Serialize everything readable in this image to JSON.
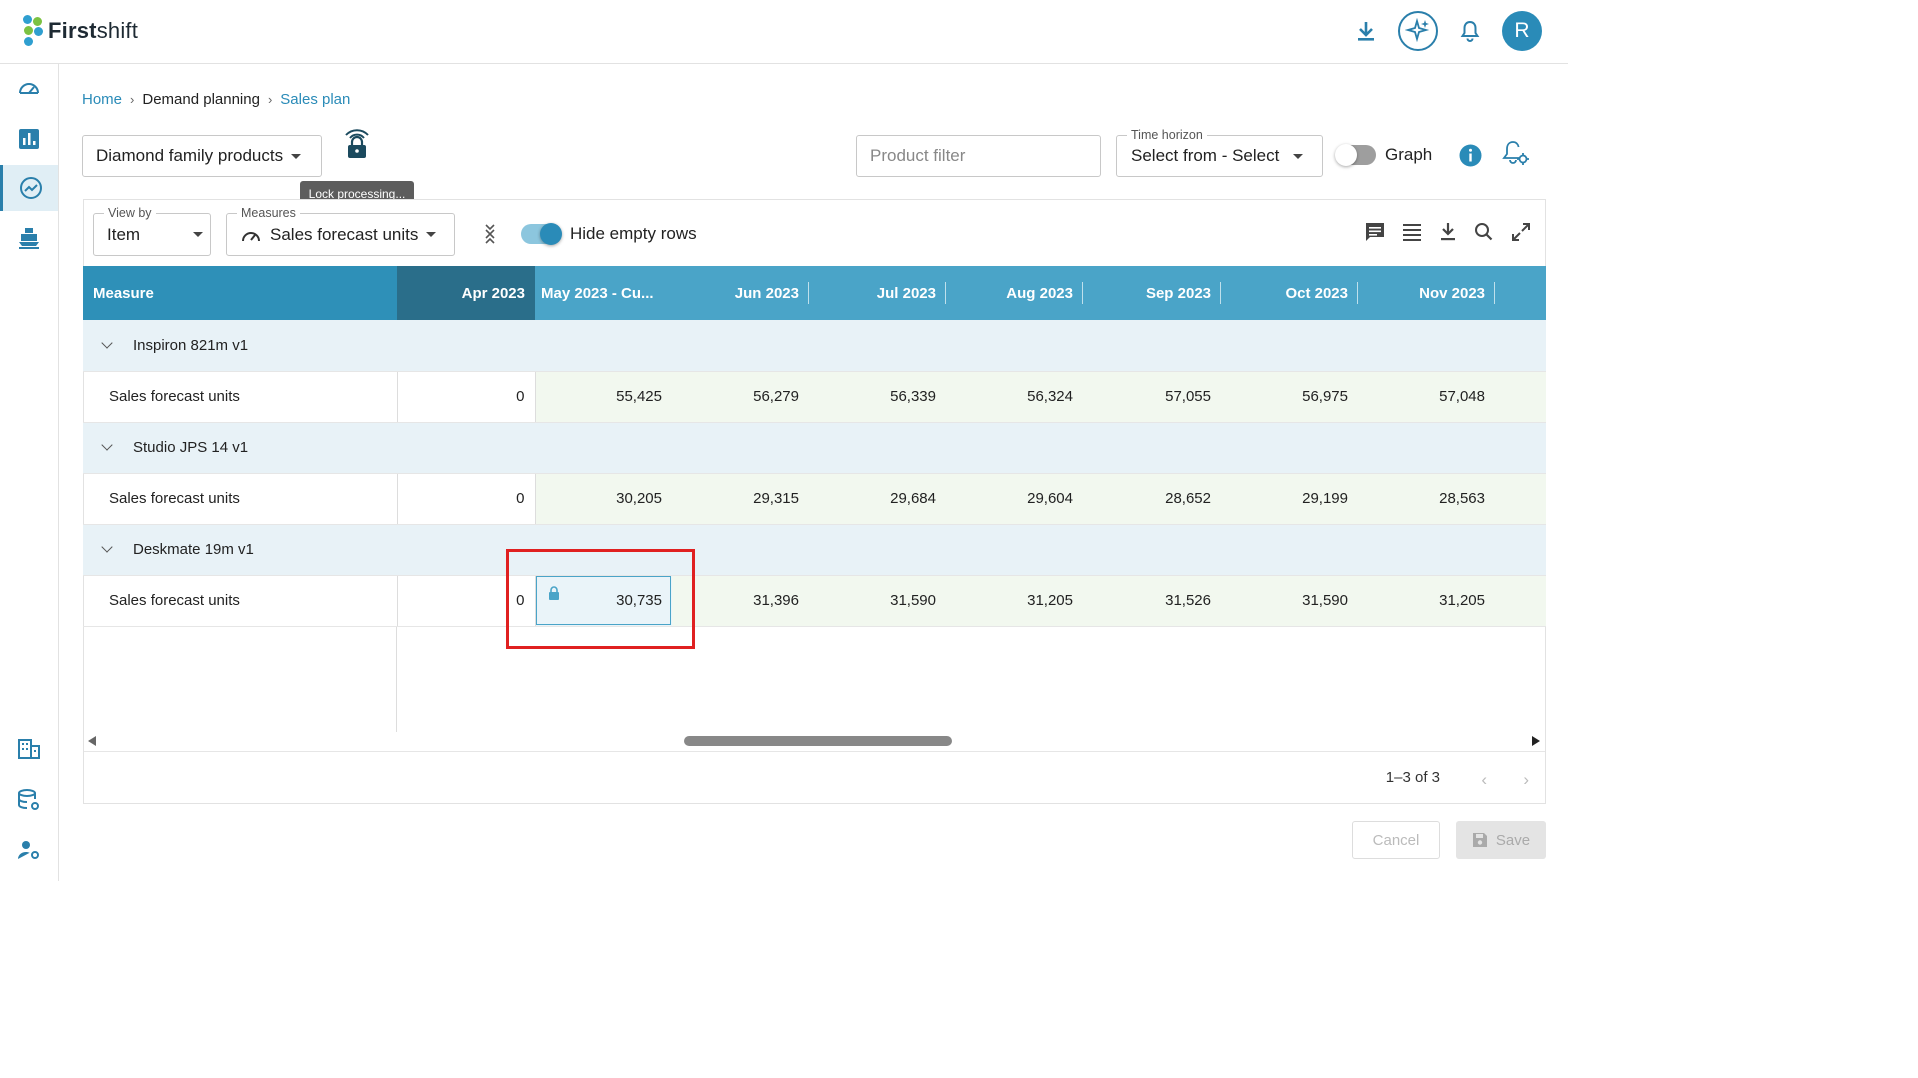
{
  "app": {
    "logo_bold": "First",
    "logo_rest": "shift"
  },
  "header": {
    "avatar_initial": "R",
    "icons": [
      "download-icon",
      "ai-sparkle-icon",
      "bell-icon"
    ]
  },
  "sidebar": {
    "items": [
      "dashboard-icon",
      "bar-chart-icon",
      "trend-icon",
      "ship-icon",
      "building-icon",
      "database-settings-icon",
      "user-settings-icon"
    ],
    "active": "trend-icon"
  },
  "breadcrumb": {
    "home": "Home",
    "demand": "Demand planning",
    "current": "Sales plan"
  },
  "filters": {
    "product_family": "Diamond family products",
    "lock_tooltip": "Lock processing...",
    "product_filter_placeholder": "Product filter",
    "time_horizon_label": "Time horizon",
    "time_horizon_value": "Select from - Select",
    "graph_label": "Graph",
    "graph_on": false
  },
  "toolbar": {
    "view_by_label": "View by",
    "view_by_value": "Item",
    "measures_label": "Measures",
    "measures_value": "Sales forecast units",
    "hide_empty_label": "Hide empty rows",
    "hide_empty_on": true
  },
  "grid": {
    "columns": [
      "Measure",
      "Apr 2023",
      "May 2023 - Cu...",
      "Jun 2023",
      "Jul 2023",
      "Aug 2023",
      "Sep 2023",
      "Oct 2023",
      "Nov 2023"
    ],
    "groups": [
      {
        "name": "Inspiron 821m v1",
        "measure": "Sales forecast units",
        "values": [
          "0",
          "55,425",
          "56,279",
          "56,339",
          "56,324",
          "57,055",
          "56,975",
          "57,048"
        ]
      },
      {
        "name": "Studio JPS 14 v1",
        "measure": "Sales forecast units",
        "values": [
          "0",
          "30,205",
          "29,315",
          "29,684",
          "29,604",
          "28,652",
          "29,199",
          "28,563"
        ]
      },
      {
        "name": "Deskmate 19m v1",
        "measure": "Sales forecast units",
        "values": [
          "0",
          "30,735",
          "31,396",
          "31,590",
          "31,205",
          "31,526",
          "31,590",
          "31,205"
        ]
      }
    ]
  },
  "pager": {
    "range": "1–3 of 3"
  },
  "footer": {
    "cancel": "Cancel",
    "save": "Save"
  },
  "colors": {
    "accent": "#2a7fab",
    "header_bg": "#4aa4c8",
    "highlight": "#e02020"
  }
}
